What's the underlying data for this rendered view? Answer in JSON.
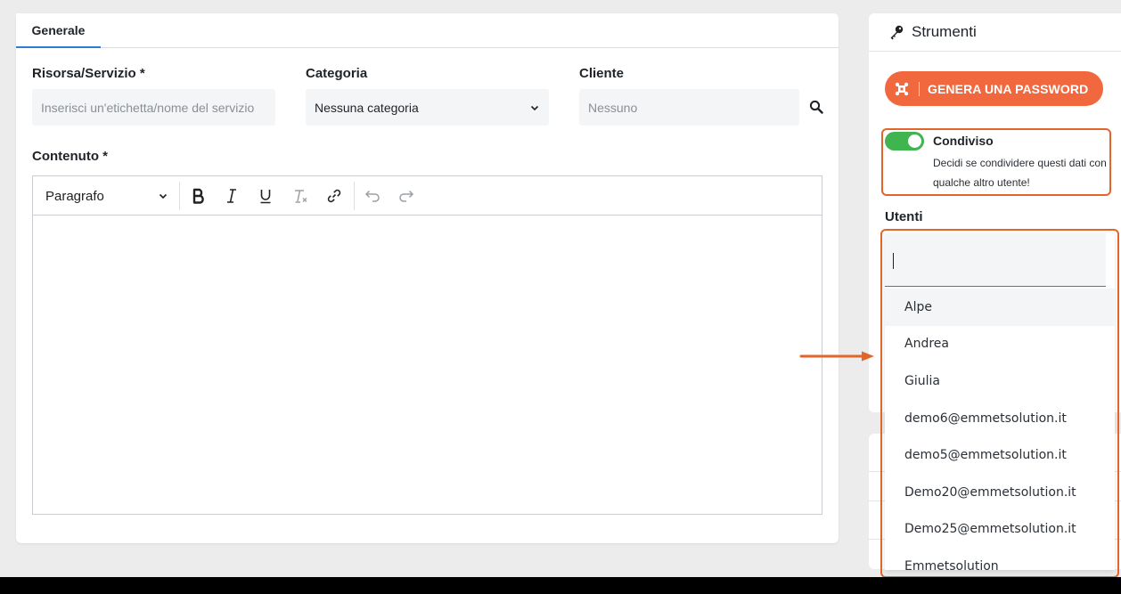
{
  "tabs": {
    "generale": "Generale"
  },
  "form": {
    "resource_label": "Risorsa/Servizio *",
    "resource_placeholder": "Inserisci un'etichetta/nome del servizio",
    "category_label": "Categoria",
    "category_value": "Nessuna categoria",
    "client_label": "Cliente",
    "client_placeholder": "Nessuno",
    "content_label": "Contenuto *"
  },
  "editor": {
    "paragraph_style": "Paragrafo",
    "tools": [
      "bold-icon",
      "italic-icon",
      "underline-icon",
      "clear-format-icon",
      "link-icon",
      "undo-icon",
      "redo-icon"
    ]
  },
  "sidebar": {
    "title": "Strumenti",
    "generate_button": "GENERA UNA PASSWORD",
    "shared_title": "Condiviso",
    "shared_description": "Decidi se condividere questi dati con qualche altro utente!",
    "shared_enabled": true,
    "users_label": "Utenti"
  },
  "users_dropdown": {
    "search_value": "",
    "options": [
      "Alpe",
      "Andrea",
      "Giulia",
      "demo6@emmetsolution.it",
      "demo5@emmetsolution.it",
      "Demo20@emmetsolution.it",
      "Demo25@emmetsolution.it",
      "Emmetsolution"
    ]
  },
  "colors": {
    "accent": "#2a7fd4",
    "generate_button": "#f2683e",
    "toggle_on": "#3fb44f",
    "annotation": "#e2652a"
  }
}
